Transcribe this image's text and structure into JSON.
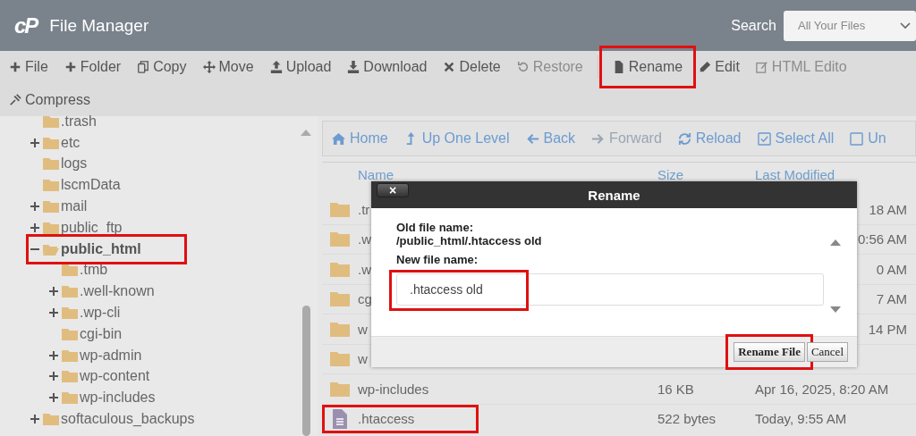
{
  "header": {
    "logo": "cP",
    "title": "File Manager",
    "search_label": "Search",
    "search_scope": "All Your Files"
  },
  "toolbar": [
    [
      {
        "label": "File",
        "disabled": false,
        "highlighted": false
      },
      {
        "label": "Folder",
        "disabled": false,
        "highlighted": false
      },
      {
        "label": "Copy",
        "disabled": false,
        "highlighted": false
      },
      {
        "label": "Move",
        "disabled": false,
        "highlighted": false
      },
      {
        "label": "Upload",
        "disabled": false,
        "highlighted": false
      },
      {
        "label": "Download",
        "disabled": false,
        "highlighted": false
      },
      {
        "label": "Delete",
        "disabled": false,
        "highlighted": false
      },
      {
        "label": "Restore",
        "disabled": true,
        "highlighted": false
      },
      {
        "label": "Rename",
        "disabled": false,
        "highlighted": true
      },
      {
        "label": "Edit",
        "disabled": false,
        "highlighted": false
      },
      {
        "label": "HTML Edito",
        "disabled": true,
        "highlighted": false
      }
    ],
    [
      {
        "label": "Compress",
        "disabled": false,
        "highlighted": false
      }
    ]
  ],
  "tree": [
    {
      "label": ".trash",
      "expandable": false,
      "expanded": false,
      "selected": false,
      "highlighted": false
    },
    {
      "label": "etc",
      "expandable": true,
      "expanded": false,
      "selected": false,
      "highlighted": false
    },
    {
      "label": "logs",
      "expandable": false,
      "expanded": false,
      "selected": false,
      "highlighted": false
    },
    {
      "label": "lscmData",
      "expandable": false,
      "expanded": false,
      "selected": false,
      "highlighted": false
    },
    {
      "label": "mail",
      "expandable": true,
      "expanded": false,
      "selected": false,
      "highlighted": false
    },
    {
      "label": "public_ftp",
      "expandable": true,
      "expanded": false,
      "selected": false,
      "highlighted": false
    },
    {
      "label": "public_html",
      "expandable": true,
      "expanded": true,
      "selected": true,
      "highlighted": true,
      "children": [
        {
          "label": ".tmb",
          "expandable": false,
          "selected": false,
          "highlighted": false
        },
        {
          "label": ".well-known",
          "expandable": true,
          "selected": false,
          "highlighted": false
        },
        {
          "label": ".wp-cli",
          "expandable": true,
          "selected": false,
          "highlighted": false
        },
        {
          "label": "cgi-bin",
          "expandable": false,
          "selected": false,
          "highlighted": false
        },
        {
          "label": "wp-admin",
          "expandable": true,
          "selected": false,
          "highlighted": false
        },
        {
          "label": "wp-content",
          "expandable": true,
          "selected": false,
          "highlighted": false
        },
        {
          "label": "wp-includes",
          "expandable": true,
          "selected": false,
          "highlighted": false
        }
      ]
    },
    {
      "label": "softaculous_backups",
      "expandable": true,
      "expanded": false,
      "selected": false,
      "highlighted": false
    }
  ],
  "nav": [
    {
      "label": "Home",
      "disabled": false
    },
    {
      "label": "Up One Level",
      "disabled": false
    },
    {
      "label": "Back",
      "disabled": false
    },
    {
      "label": "Forward",
      "disabled": true
    },
    {
      "label": "Reload",
      "disabled": false
    },
    {
      "label": "Select All",
      "disabled": false
    },
    {
      "label": "Un",
      "disabled": false
    }
  ],
  "table": {
    "columns": [
      "Name",
      "Size",
      "Last Modified"
    ],
    "rows": [
      {
        "kind": "folder",
        "name": ".tr",
        "modified": "18 AM",
        "highlighted": false
      },
      {
        "kind": "folder",
        "name": ".w",
        "modified": "0:56 AM",
        "highlighted": false
      },
      {
        "kind": "folder",
        "name": ".w",
        "modified": "0 AM",
        "highlighted": false
      },
      {
        "kind": "folder",
        "name": "cg",
        "modified": "7 AM",
        "highlighted": false
      },
      {
        "kind": "folder",
        "name": "w",
        "modified": "14 PM",
        "highlighted": false
      },
      {
        "kind": "folder",
        "name": "w",
        "highlighted": false
      },
      {
        "kind": "folder",
        "name": "wp-includes",
        "size": "16 KB",
        "modified": "Apr 16, 2025, 8:20 AM",
        "highlighted": false
      },
      {
        "kind": "file",
        "name": ".htaccess",
        "size": "522 bytes",
        "modified": "Today, 9:55 AM",
        "highlighted": true
      }
    ]
  },
  "dialog": {
    "title": "Rename",
    "close": "×",
    "old_label": "Old file name:",
    "old_value": "/public_html/.htaccess old",
    "new_label": "New file name:",
    "new_value": ".htaccess old",
    "new_highlighted": true,
    "buttons": [
      {
        "label": "Rename File",
        "kind": "primary",
        "highlighted": true
      },
      {
        "label": "Cancel",
        "kind": "secondary",
        "highlighted": false
      }
    ]
  }
}
